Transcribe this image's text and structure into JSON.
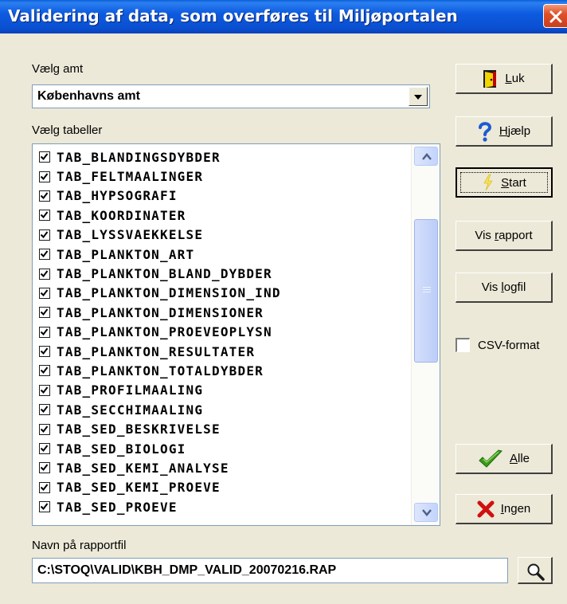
{
  "window": {
    "title": "Validering af data, som overføres til Miljøportalen"
  },
  "amt": {
    "label": "Vælg amt",
    "value": "Københavns amt"
  },
  "tables": {
    "label": "Vælg tabeller",
    "items": [
      {
        "name": "TAB_BLANDINGSDYBDER",
        "checked": true
      },
      {
        "name": "TAB_FELTMAALINGER",
        "checked": true
      },
      {
        "name": "TAB_HYPSOGRAFI",
        "checked": true
      },
      {
        "name": "TAB_KOORDINATER",
        "checked": true
      },
      {
        "name": "TAB_LYSSVAEKKELSE",
        "checked": true
      },
      {
        "name": "TAB_PLANKTON_ART",
        "checked": true
      },
      {
        "name": "TAB_PLANKTON_BLAND_DYBDER",
        "checked": true
      },
      {
        "name": "TAB_PLANKTON_DIMENSION_IND",
        "checked": true
      },
      {
        "name": "TAB_PLANKTON_DIMENSIONER",
        "checked": true
      },
      {
        "name": "TAB_PLANKTON_PROEVEOPLYSN",
        "checked": true
      },
      {
        "name": "TAB_PLANKTON_RESULTATER",
        "checked": true
      },
      {
        "name": "TAB_PLANKTON_TOTALDYBDER",
        "checked": true
      },
      {
        "name": "TAB_PROFILMAALING",
        "checked": true
      },
      {
        "name": "TAB_SECCHIMAALING",
        "checked": true
      },
      {
        "name": "TAB_SED_BESKRIVELSE",
        "checked": true
      },
      {
        "name": "TAB_SED_BIOLOGI",
        "checked": true
      },
      {
        "name": "TAB_SED_KEMI_ANALYSE",
        "checked": true
      },
      {
        "name": "TAB_SED_KEMI_PROEVE",
        "checked": true
      },
      {
        "name": "TAB_SED_PROEVE",
        "checked": true
      }
    ]
  },
  "buttons": {
    "luk": {
      "pre": "",
      "mnemonic": "L",
      "post": "uk",
      "icon": "door-exit-icon"
    },
    "hjaelp": {
      "pre": "",
      "mnemonic": "H",
      "post": "jælp",
      "icon": "question-mark-icon"
    },
    "start": {
      "pre": "",
      "mnemonic": "S",
      "post": "tart",
      "icon": "lightning-icon"
    },
    "vis_rapport": {
      "pre": "Vis ",
      "mnemonic": "r",
      "post": "apport"
    },
    "vis_logfil": {
      "pre": "Vis ",
      "mnemonic": "l",
      "post": "ogfil"
    },
    "alle": {
      "pre": "",
      "mnemonic": "A",
      "post": "lle",
      "icon": "green-checkmark-icon"
    },
    "ingen": {
      "pre": "",
      "mnemonic": "I",
      "post": "ngen",
      "icon": "red-x-icon"
    }
  },
  "csv": {
    "label": "CSV-format",
    "checked": false
  },
  "report": {
    "label": "Navn på rapportfil",
    "value": "C:\\STOQ\\VALID\\KBH_DMP_VALID_20070216.RAP"
  },
  "colors": {
    "titlebar": "#0a4fd0",
    "dialog_bg": "#ece9d8",
    "scrollbar": "#c3d3fd"
  }
}
